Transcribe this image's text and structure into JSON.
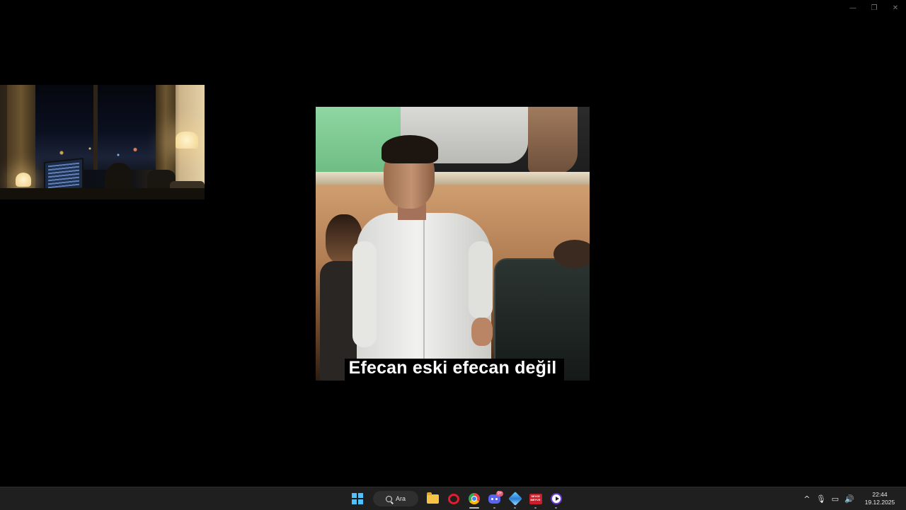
{
  "window": {
    "minimize_glyph": "—",
    "restore_glyph": "❐",
    "close_glyph": "✕"
  },
  "webcam": {
    "description_icon": "webcam-feed"
  },
  "video": {
    "subtitle": "Efecan eski efecan değil"
  },
  "taskbar": {
    "search_label": "Ara",
    "apps": [
      "start",
      "search",
      "file-explorer",
      "opera",
      "chrome",
      "discord",
      "app-diamond",
      "app-red",
      "media-player"
    ],
    "discord_badge": "9+",
    "red_app_text": "SEVGİ MEYVE",
    "tray": {
      "chevron_glyph": "^",
      "mic_glyph": "🎙",
      "display_glyph": "▭",
      "volume_glyph": "🔊"
    },
    "clock": {
      "time": "22:44",
      "date": "19.12.2025"
    },
    "accent": "#4cc2ff"
  }
}
